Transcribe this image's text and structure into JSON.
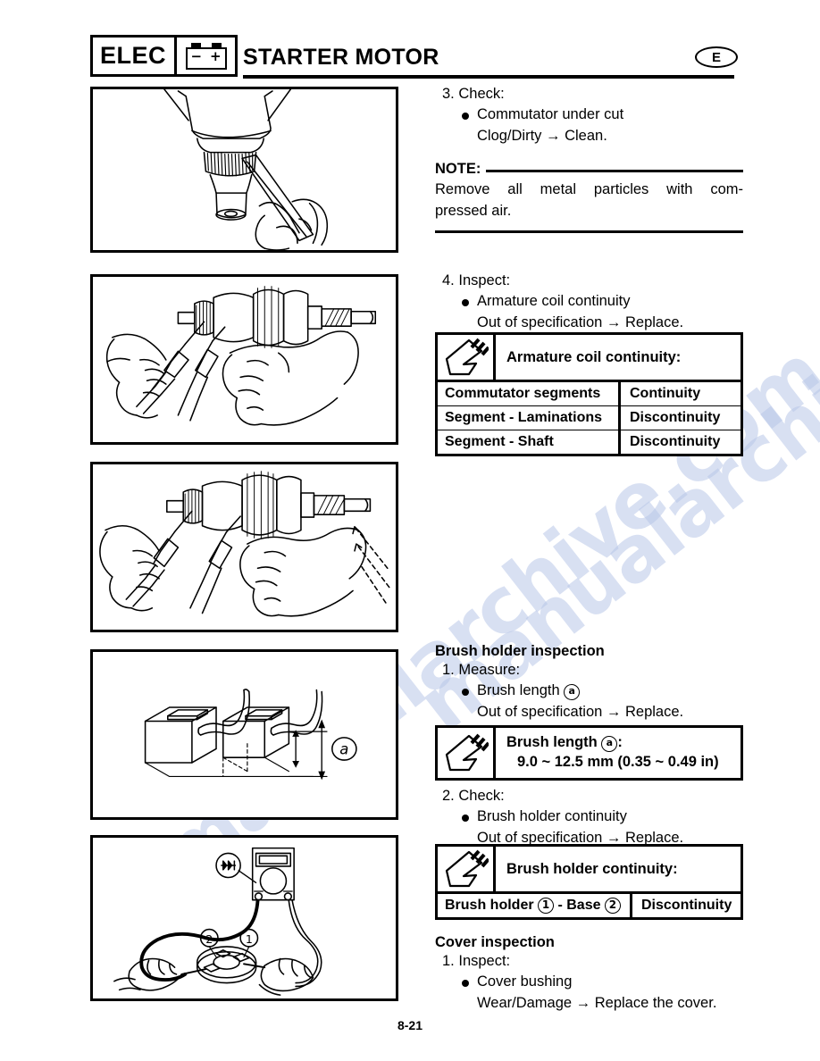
{
  "header": {
    "section_code": "ELEC",
    "battery_icon": "battery-icon",
    "title": "STARTER MOTOR",
    "language_badge": "E"
  },
  "watermark": {
    "line1": "manualarchive.com",
    "line2": "manualarchive.com"
  },
  "figures": [
    {
      "name": "commutator-undercut-figure",
      "caption": "Hand holding hacksaw blade undercutting commutator mica"
    },
    {
      "name": "armature-segment-continuity-figure",
      "caption": "Two tester probes on adjacent commutator segments of armature"
    },
    {
      "name": "armature-segment-laminations-shaft-figure",
      "caption": "Tester probes on commutator segment and laminations with dashed arrows to shaft"
    },
    {
      "name": "brush-length-figure",
      "caption": "Two carbon brushes with pigtail leads and brush length dimension a"
    },
    {
      "name": "brush-holder-continuity-figure",
      "caption": "Pocket tester connected to brush holder 1 and base 2"
    }
  ],
  "right_column": {
    "step3": {
      "number": "3.",
      "action": "Check:",
      "bullet": "Commutator under cut",
      "result": "Clog/Dirty → Clean."
    },
    "note": {
      "label": "NOTE:",
      "line1": "Remove all metal particles with com-",
      "line2": "pressed air."
    },
    "step4": {
      "number": "4.",
      "action": "Inspect:",
      "bullet": "Armature coil continuity",
      "result": "Out of specification → Replace."
    },
    "armature_table": {
      "tool_icon": "pocket-tester-icon",
      "title": "Armature coil continuity:",
      "rows": [
        {
          "label": "Commutator segments",
          "value": "Continuity"
        },
        {
          "label": "Segment - Laminations",
          "value": "Discontinuity"
        },
        {
          "label": "Segment - Shaft",
          "value": "Discontinuity"
        }
      ]
    },
    "brush_holder_section": {
      "heading": "Brush holder inspection",
      "step1": {
        "number": "1.",
        "action": "Measure:",
        "bullet_prefix": "Brush length ",
        "bullet_mark": "a",
        "result": "Out of specification → Replace."
      },
      "brush_length_table": {
        "tool_icon": "pocket-tester-icon",
        "title_prefix": "Brush length ",
        "title_mark": "a",
        "title_suffix": ":",
        "value": "9.0 ~ 12.5 mm (0.35 ~ 0.49 in)"
      },
      "step2": {
        "number": "2.",
        "action": "Check:",
        "bullet": "Brush holder continuity",
        "result": "Out of specification → Replace."
      },
      "brush_holder_table": {
        "tool_icon": "pocket-tester-icon",
        "title": "Brush holder continuity:",
        "row_prefix": "Brush holder ",
        "row_mark1": "1",
        "row_middle": " - Base ",
        "row_mark2": "2",
        "row_value": "Discontinuity"
      }
    },
    "cover_section": {
      "heading": "Cover inspection",
      "step1": {
        "number": "1.",
        "action": "Inspect:",
        "bullet": "Cover bushing",
        "result": "Wear/Damage → Replace the cover."
      }
    }
  },
  "footer": {
    "page_number": "8-21"
  }
}
